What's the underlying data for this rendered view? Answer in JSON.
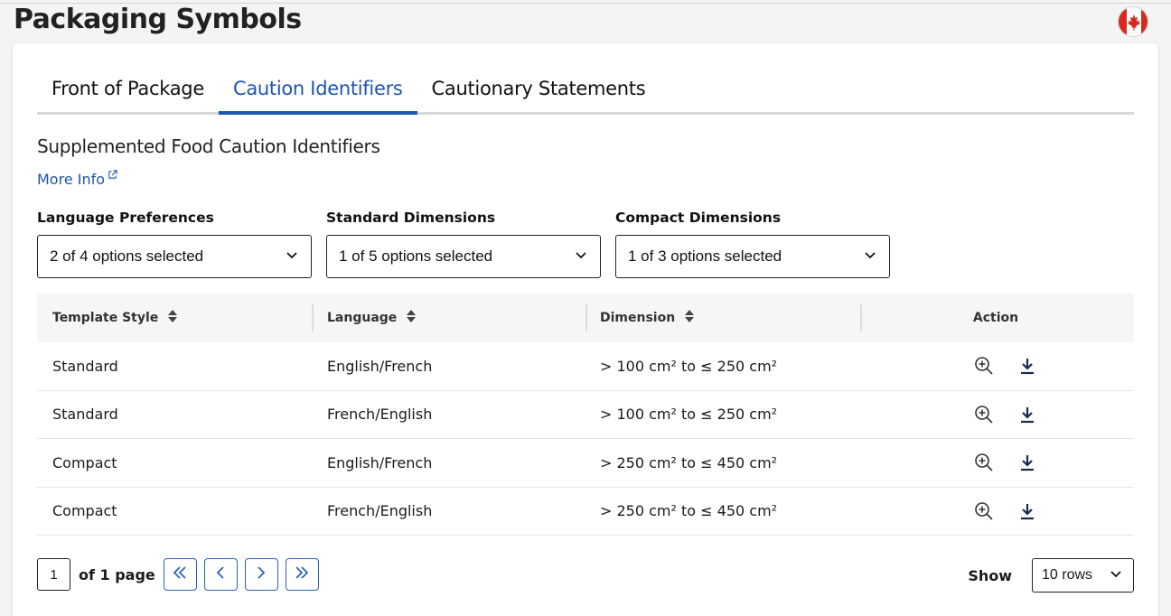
{
  "header": {
    "title": "Packaging Symbols",
    "flag_icon": "canada-flag-icon"
  },
  "tabs": [
    {
      "label": "Front of Package",
      "active": false
    },
    {
      "label": "Caution Identifiers",
      "active": true
    },
    {
      "label": "Cautionary Statements",
      "active": false
    }
  ],
  "section": {
    "title": "Supplemented Food Caution Identifiers",
    "more_info": "More Info",
    "more_info_icon": "external-link-icon"
  },
  "filters": {
    "language": {
      "label": "Language Preferences",
      "value": "2 of 4 options selected"
    },
    "standard": {
      "label": "Standard Dimensions",
      "value": "1 of 5 options selected"
    },
    "compact": {
      "label": "Compact Dimensions",
      "value": "1 of 3 options selected"
    }
  },
  "table": {
    "headers": {
      "template_style": "Template Style",
      "language": "Language",
      "dimension": "Dimension",
      "action": "Action"
    },
    "rows": [
      {
        "template_style": "Standard",
        "language": "English/French",
        "dimension": "> 100 cm² to ≤ 250 cm²"
      },
      {
        "template_style": "Standard",
        "language": "French/English",
        "dimension": "> 100 cm² to ≤ 250 cm²"
      },
      {
        "template_style": "Compact",
        "language": "English/French",
        "dimension": "> 250 cm² to ≤ 450 cm²"
      },
      {
        "template_style": "Compact",
        "language": "French/English",
        "dimension": "> 250 cm² to ≤ 450 cm²"
      }
    ],
    "action_icons": [
      "zoom-in-icon",
      "download-icon"
    ]
  },
  "pagination": {
    "current_page": "1",
    "of_label": "of 1 page",
    "show_label": "Show",
    "rows_value": "10 rows"
  },
  "colors": {
    "accent": "#1f55ad",
    "flag_red": "#d52b1e"
  }
}
